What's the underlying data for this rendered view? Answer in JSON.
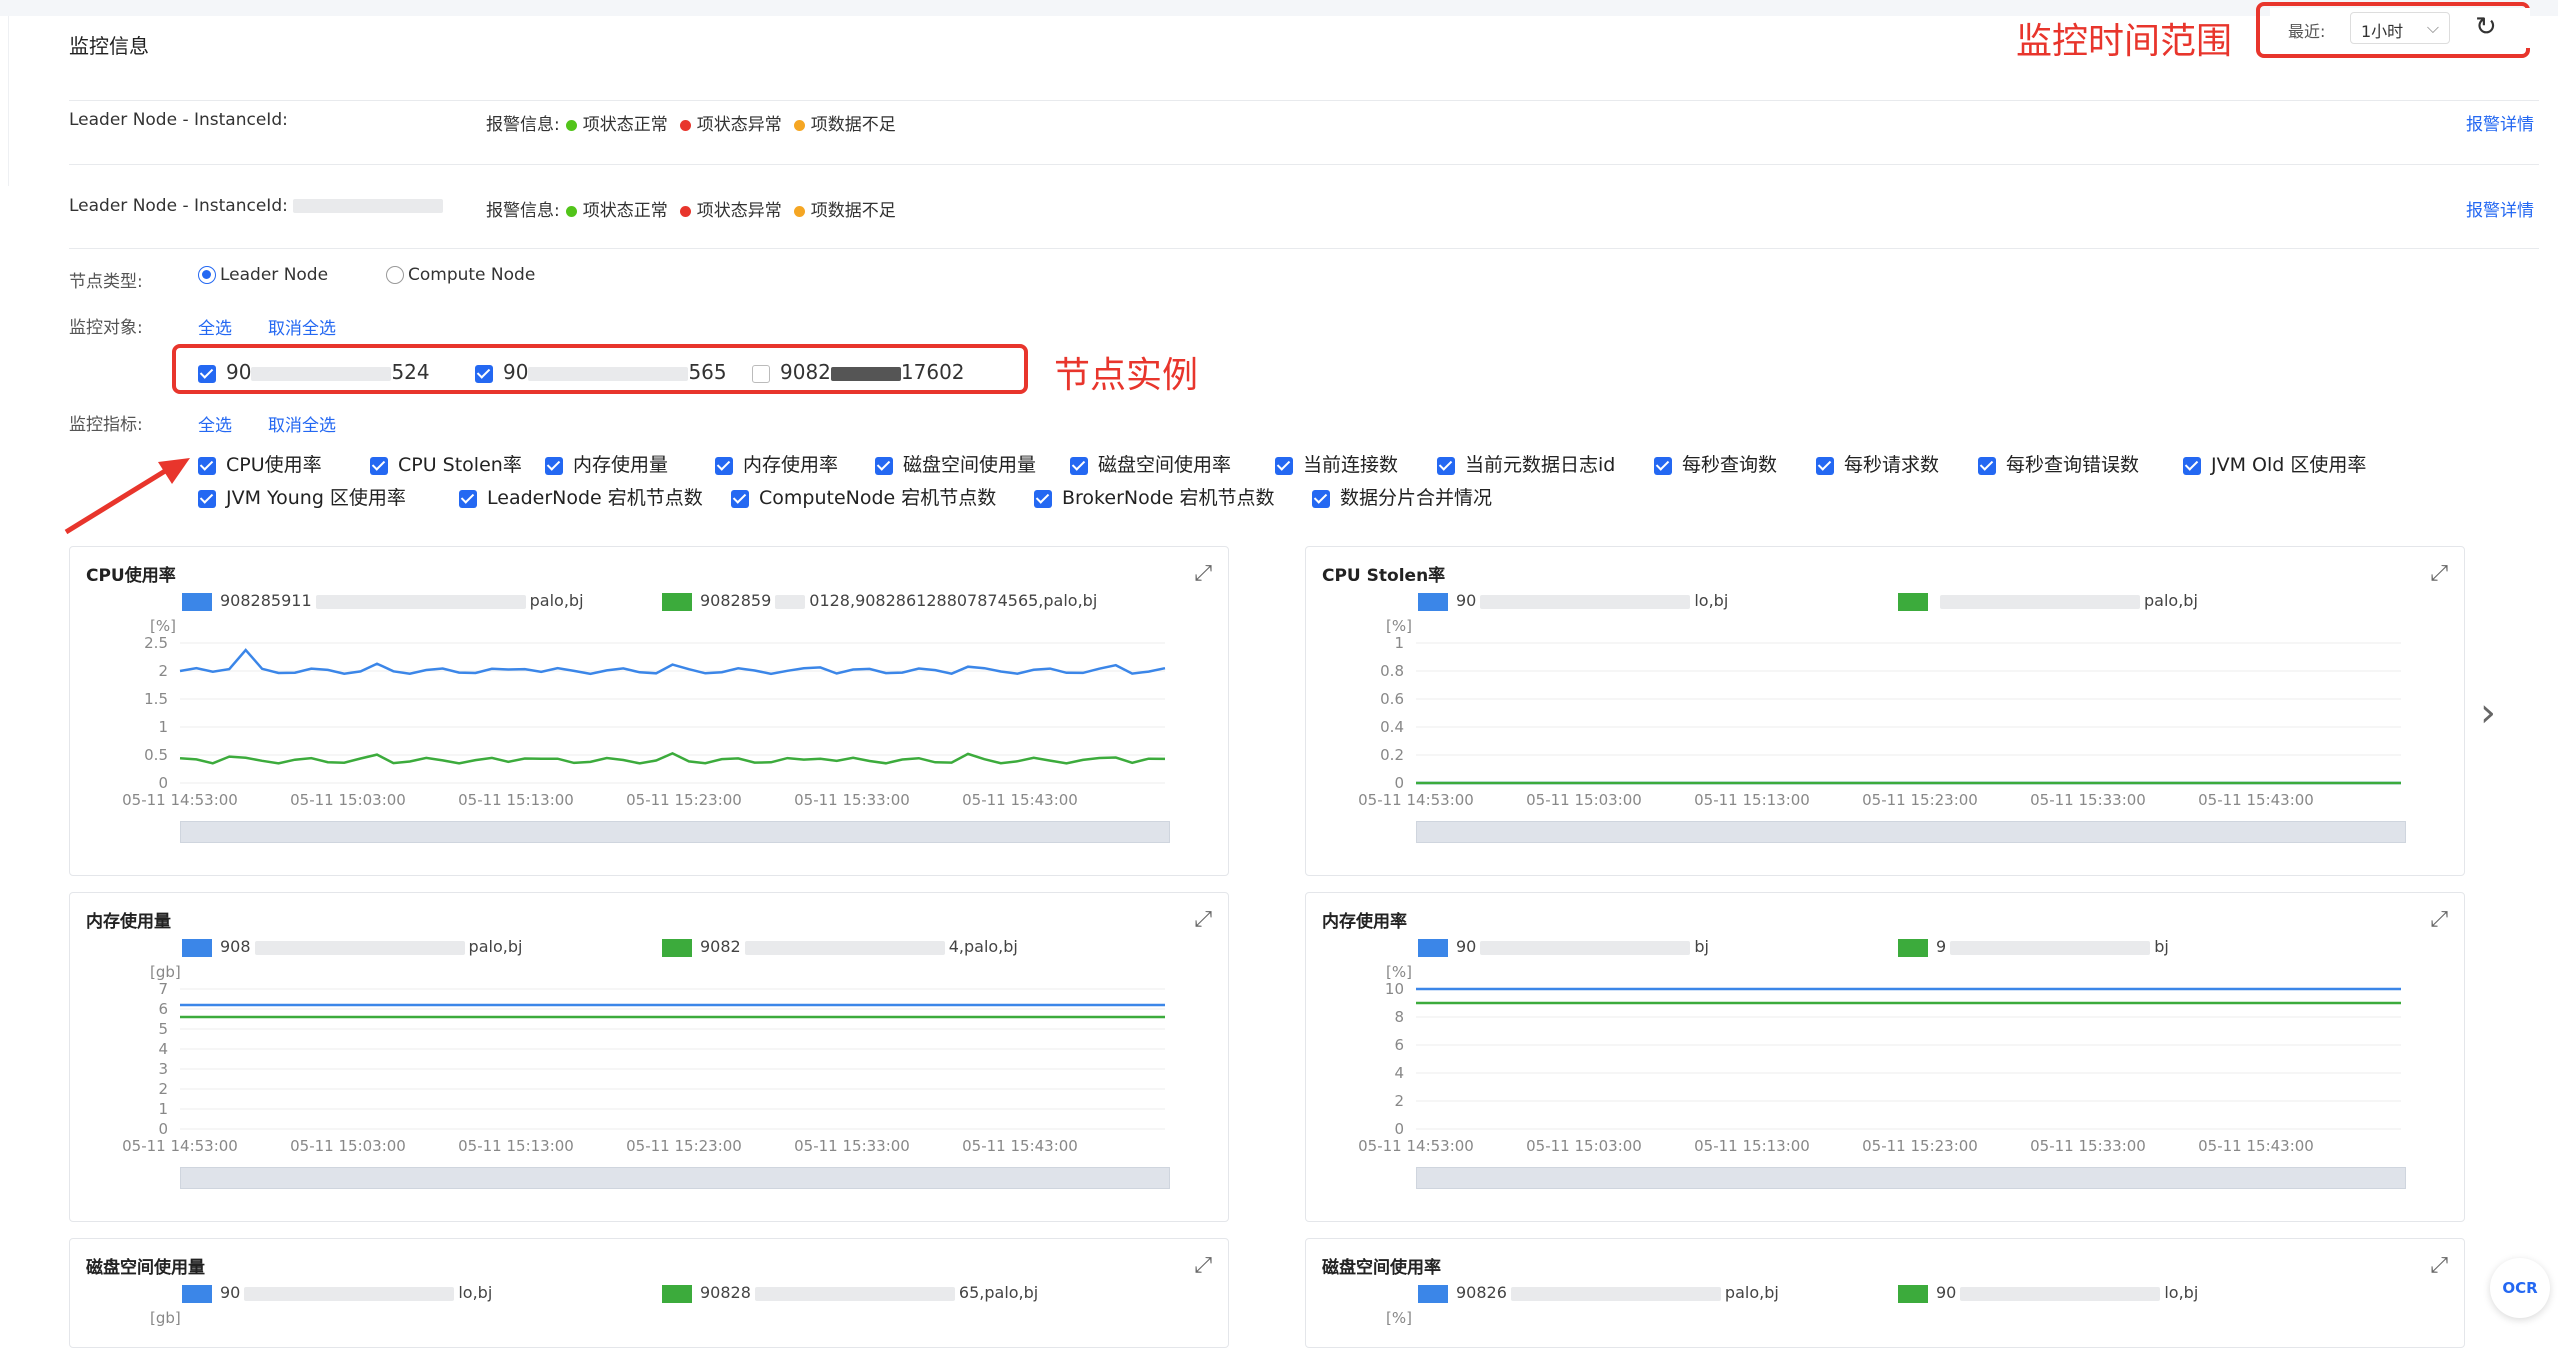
{
  "header": {
    "section_title": "监控信息",
    "recent_label": "最近:",
    "recent_value": "1小时",
    "refresh_icon": "refresh-icon",
    "annotation_time": "监控时间范围"
  },
  "leader_rows": [
    {
      "label": "Leader Node - InstanceId:",
      "alarm_prefix": "报警信息:",
      "ok": "项状态正常",
      "err": "项状态异常",
      "insufficient": "项数据不足",
      "detail": "报警详情"
    },
    {
      "label": "Leader Node - InstanceId:",
      "alarm_prefix": "报警信息:",
      "ok": "项状态正常",
      "err": "项状态异常",
      "insufficient": "项数据不足",
      "detail": "报警详情"
    }
  ],
  "status_colors": {
    "ok": "#52c41a",
    "err": "#e8352c",
    "insufficient": "#f5a623"
  },
  "node_type": {
    "label": "节点类型:",
    "options": [
      "Leader Node",
      "Compute Node"
    ],
    "selected": "Leader Node"
  },
  "monitor_target": {
    "label": "监控对象:",
    "select_all": "全选",
    "clear_all": "取消全选",
    "instances": [
      {
        "prefix": "90",
        "suffix": "524",
        "checked": true
      },
      {
        "prefix": "90",
        "suffix": "565",
        "checked": true
      },
      {
        "prefix": "9082",
        "suffix": "17602",
        "checked": false
      }
    ],
    "annotation": "节点实例"
  },
  "monitor_metric": {
    "label": "监控指标:",
    "select_all": "全选",
    "clear_all": "取消全选",
    "metrics": [
      "CPU使用率",
      "CPU Stolen率",
      "内存使用量",
      "内存使用率",
      "磁盘空间使用量",
      "磁盘空间使用率",
      "当前连接数",
      "当前元数据日志id",
      "每秒查询数",
      "每秒请求数",
      "每秒查询错误数",
      "JVM Old 区使用率",
      "JVM Young 区使用率",
      "LeaderNode 宕机节点数",
      "ComputeNode 宕机节点数",
      "BrokerNode 宕机节点数",
      "数据分片合并情况"
    ]
  },
  "series_colors": [
    "#3b86e8",
    "#3cab3c"
  ],
  "x_ticks": [
    "05-11 14:53:00",
    "05-11 15:03:00",
    "05-11 15:13:00",
    "05-11 15:23:00",
    "05-11 15:33:00",
    "05-11 15:43:00"
  ],
  "charts": [
    {
      "title": "CPU使用率",
      "unit": "[%]",
      "legend_a_head": "908285911",
      "legend_a_tail": "palo,bj",
      "legend_b_head": "9082859",
      "legend_b_tail": "0128,908286128807874565,palo,bj",
      "y_ticks": [
        "2.5",
        "2",
        "1.5",
        "1",
        "0.5",
        "0"
      ],
      "ymax": 2.5,
      "series": [
        2.0,
        0.4
      ],
      "slider": true
    },
    {
      "title": "CPU Stolen率",
      "unit": "[%]",
      "legend_a_head": "90",
      "legend_a_tail": "lo,bj",
      "legend_b_head": "",
      "legend_b_tail": "palo,bj",
      "y_ticks": [
        "1",
        "0.8",
        "0.6",
        "0.4",
        "0.2",
        "0"
      ],
      "ymax": 1,
      "series": [
        0,
        0
      ],
      "slider": true
    },
    {
      "title": "内存使用量",
      "unit": "[gb]",
      "legend_a_head": "908",
      "legend_a_tail": "palo,bj",
      "legend_b_head": "9082",
      "legend_b_tail": "4,palo,bj",
      "y_ticks": [
        "7",
        "6",
        "5",
        "4",
        "3",
        "2",
        "1",
        "0"
      ],
      "ymax": 7,
      "series": [
        6.2,
        5.6
      ],
      "slider": true
    },
    {
      "title": "内存使用率",
      "unit": "[%]",
      "legend_a_head": "90",
      "legend_a_tail": "bj",
      "legend_b_head": "9",
      "legend_b_tail": "bj",
      "y_ticks": [
        "10",
        "8",
        "6",
        "4",
        "2",
        "0"
      ],
      "ymax": 10,
      "series": [
        10,
        9
      ],
      "slider": true
    },
    {
      "title": "磁盘空间使用量",
      "unit": "[gb]",
      "legend_a_head": "90",
      "legend_a_tail": "lo,bj",
      "legend_b_head": "90828",
      "legend_b_tail": "65,palo,bj",
      "y_ticks": [],
      "ymax": 1,
      "series": [],
      "slider": false
    },
    {
      "title": "磁盘空间使用率",
      "unit": "[%]",
      "legend_a_head": "90826",
      "legend_a_tail": "palo,bj",
      "legend_b_head": "90",
      "legend_b_tail": "lo,bj",
      "y_ticks": [],
      "ymax": 1,
      "series": [],
      "slider": false
    }
  ],
  "ocr_button": "OCR"
}
